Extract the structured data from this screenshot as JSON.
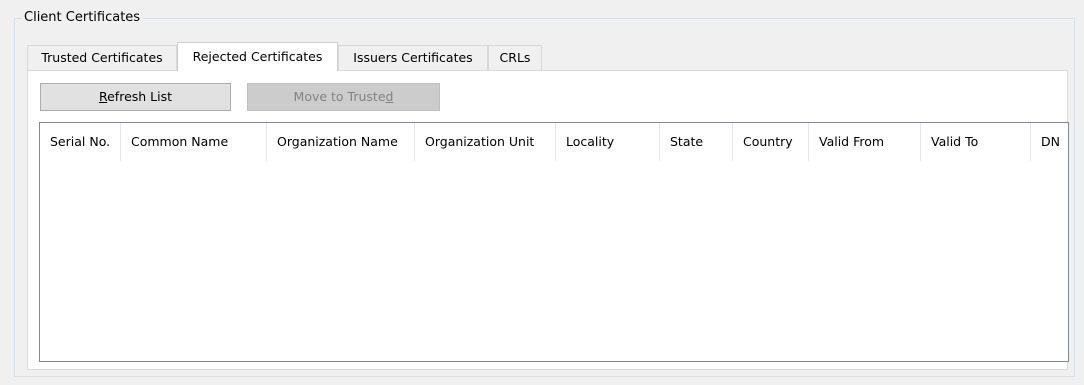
{
  "group": {
    "title": "Client Certificates"
  },
  "tabs": [
    {
      "label": "Trusted Certificates",
      "active": false
    },
    {
      "label": "Rejected Certificates",
      "active": true
    },
    {
      "label": "Issuers Certificates",
      "active": false
    },
    {
      "label": "CRLs",
      "active": false
    }
  ],
  "toolbar": {
    "refresh_pre": "",
    "refresh_mnemonic": "R",
    "refresh_post": "efresh List",
    "move_pre": "Move to Truste",
    "move_mnemonic": "d",
    "move_post": "",
    "move_enabled": false
  },
  "table": {
    "columns": [
      "Serial No.",
      "Common Name",
      "Organization Name",
      "Organization Unit",
      "Locality",
      "State",
      "Country",
      "Valid From",
      "Valid To",
      "DN"
    ],
    "rows": []
  },
  "colors": {
    "window_bg": "#f0f0f0",
    "disabled_button_bg": "#cccccc",
    "disabled_text": "#838383",
    "list_border": "#828790"
  }
}
